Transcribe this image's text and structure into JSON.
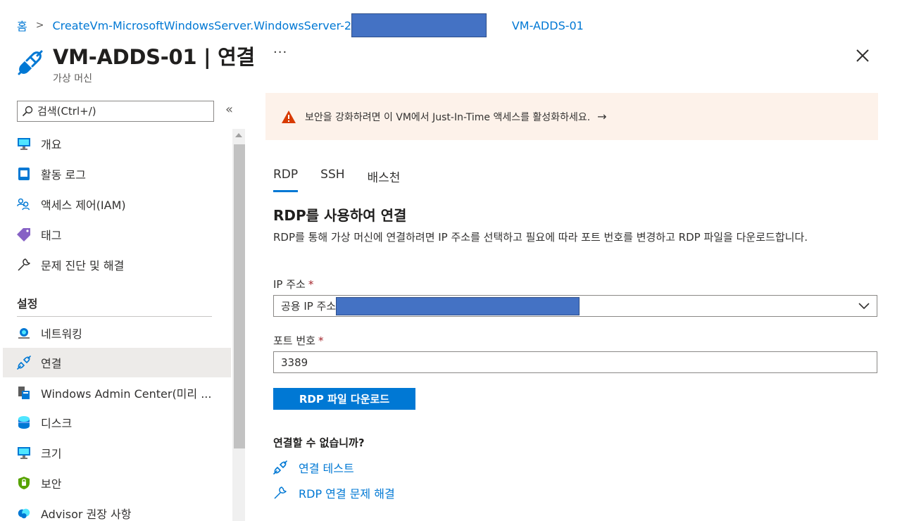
{
  "breadcrumb": {
    "home": "홈",
    "resource": "CreateVm-MicrosoftWindowsServer.WindowsServer-2",
    "current": "VM-ADDS-01"
  },
  "header": {
    "title": "VM-ADDS-01 | 연결",
    "subtitle": "가상 머신",
    "more": "···"
  },
  "sidebar": {
    "search_placeholder": "검색(Ctrl+/)",
    "collapse": "«",
    "items": [
      {
        "label": "개요",
        "icon": "monitor-icon"
      },
      {
        "label": "활동 로그",
        "icon": "log-icon"
      },
      {
        "label": "액세스 제어(IAM)",
        "icon": "people-icon"
      },
      {
        "label": "태그",
        "icon": "tag-icon"
      },
      {
        "label": "문제 진단 및 해결",
        "icon": "wrench-icon"
      }
    ],
    "section_label": "설정",
    "settings_items": [
      {
        "label": "네트워킹",
        "icon": "network-icon"
      },
      {
        "label": "연결",
        "icon": "plug-icon",
        "active": true
      },
      {
        "label": "Windows Admin Center(미리 ...",
        "icon": "server-icon"
      },
      {
        "label": "디스크",
        "icon": "disk-icon"
      },
      {
        "label": "크기",
        "icon": "monitor-icon"
      },
      {
        "label": "보안",
        "icon": "shield-icon"
      },
      {
        "label": "Advisor 권장 사항",
        "icon": "cloud-icon"
      }
    ]
  },
  "banner": {
    "text": "보안을 강화하려면 이 VM에서 Just-In-Time 액세스를 활성화하세요.",
    "arrow": "→"
  },
  "tabs": [
    "RDP",
    "SSH",
    "배스천"
  ],
  "main": {
    "section_title": "RDP를 사용하여 연결",
    "description": "RDP를 통해 가상 머신에 연결하려면 IP 주소를 선택하고 필요에 따라 포트 번호를 변경하고 RDP 파일을 다운로드합니다.",
    "ip_label": "IP 주소",
    "ip_value": "공용 IP 주소",
    "port_label": "포트 번호",
    "port_value": "3389",
    "required_mark": "*",
    "download_button": "RDP 파일 다운로드",
    "help_title": "연결할 수 없습니까?",
    "help_links": [
      "연결 테스트",
      "RDP 연결 문제 해결"
    ]
  },
  "colors": {
    "accent": "#0078d4",
    "banner_bg": "#fdf2ea",
    "warning": "#d83b01",
    "redaction": "#4472c4"
  }
}
